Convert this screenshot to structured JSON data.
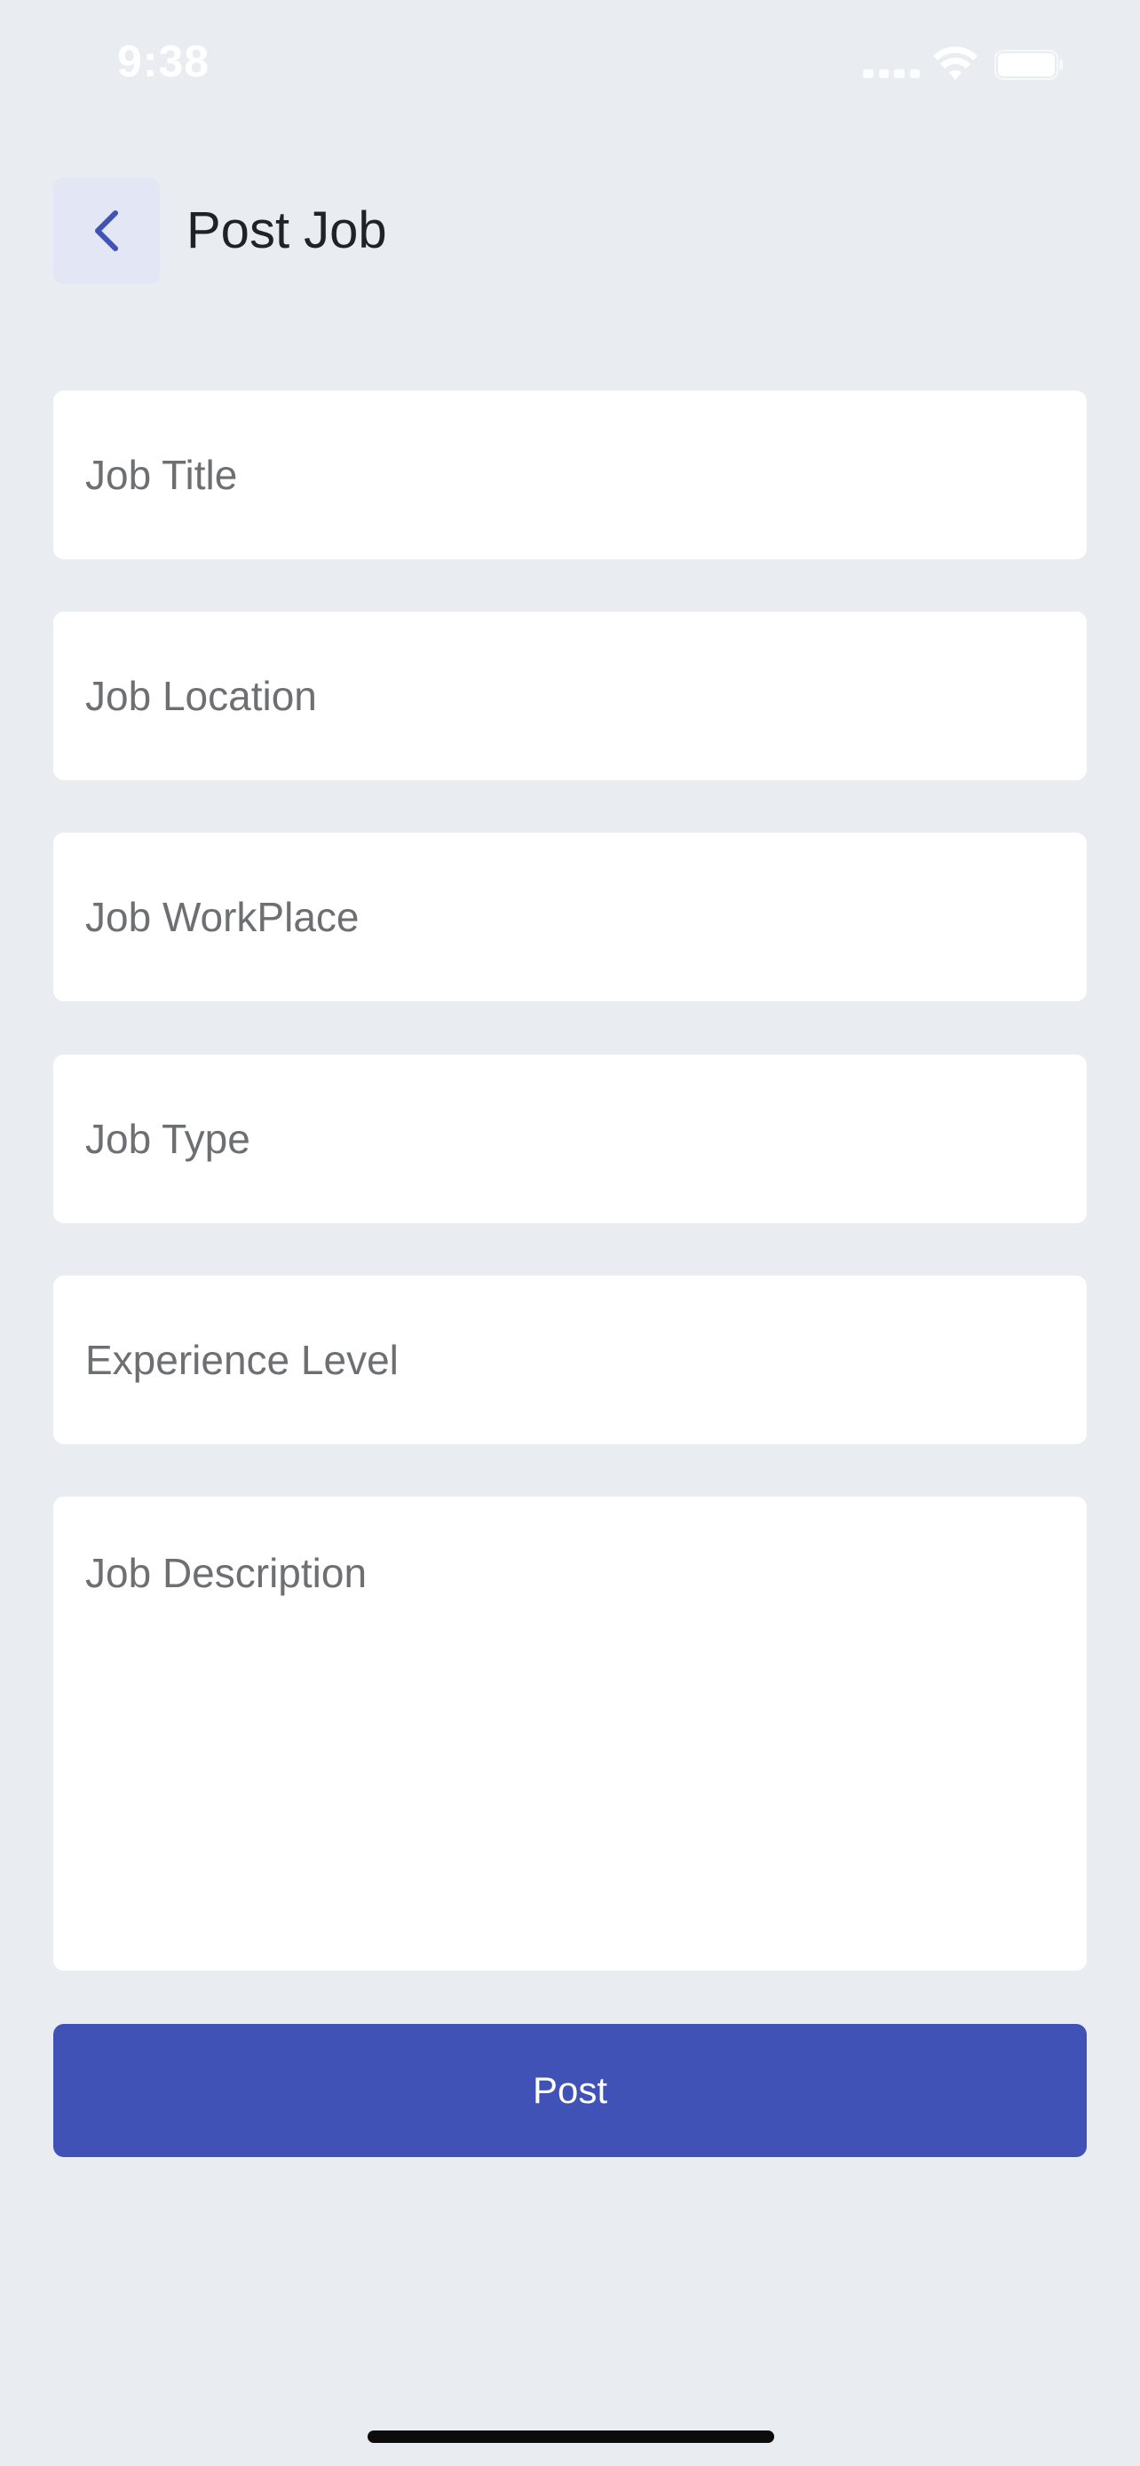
{
  "status_bar": {
    "time": "9:38"
  },
  "header": {
    "title": "Post Job",
    "back_icon": "chevron-left-icon"
  },
  "form": {
    "job_title": {
      "placeholder": "Job Title",
      "value": ""
    },
    "job_location": {
      "placeholder": "Job Location",
      "value": ""
    },
    "job_workplace": {
      "placeholder": "Job WorkPlace",
      "value": ""
    },
    "job_type": {
      "placeholder": "Job Type",
      "value": ""
    },
    "experience_level": {
      "placeholder": "Experience Level",
      "value": ""
    },
    "job_description": {
      "placeholder": "Job Description",
      "value": ""
    },
    "submit_label": "Post"
  },
  "colors": {
    "background": "#e9edf1",
    "accent": "#4052b5",
    "back_button_bg": "#e3e6f4",
    "field_bg": "#ffffff"
  }
}
